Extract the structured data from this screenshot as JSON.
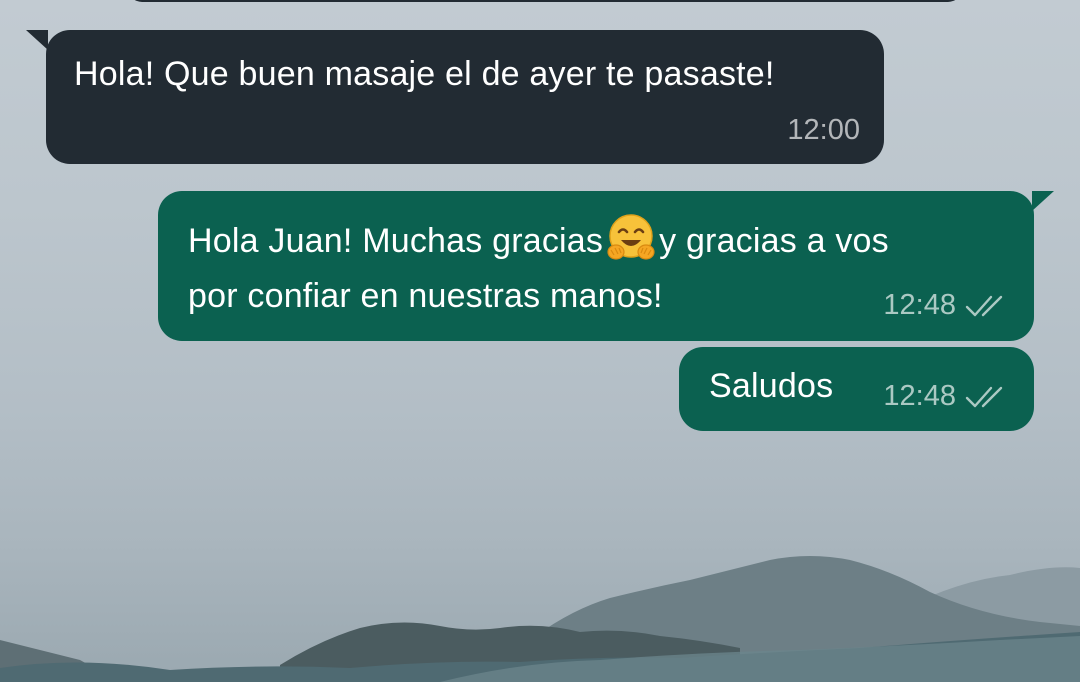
{
  "conversation": {
    "messages": [
      {
        "direction": "incoming",
        "text": "Hola! Que buen masaje el de ayer te pasaste!",
        "time": "12:00"
      },
      {
        "direction": "outgoing",
        "text_line1_before_emoji": "Hola Juan! Muchas gracias",
        "emoji": "hugging-face-emoji",
        "text_line1_after_emoji": "y gracias a vos",
        "text_line2": "por confiar en nuestras manos!",
        "time": "12:48",
        "status": "read-double-check-icon"
      },
      {
        "direction": "outgoing",
        "text": "Saludos",
        "time": "12:48",
        "status": "read-double-check-icon"
      }
    ]
  },
  "colors": {
    "incoming_bubble": "#222b33",
    "outgoing_bubble": "#0b6150",
    "text": "#ffffff",
    "time_text": "#b8c4c2",
    "wallpaper_sky": "#bcc6cd"
  }
}
